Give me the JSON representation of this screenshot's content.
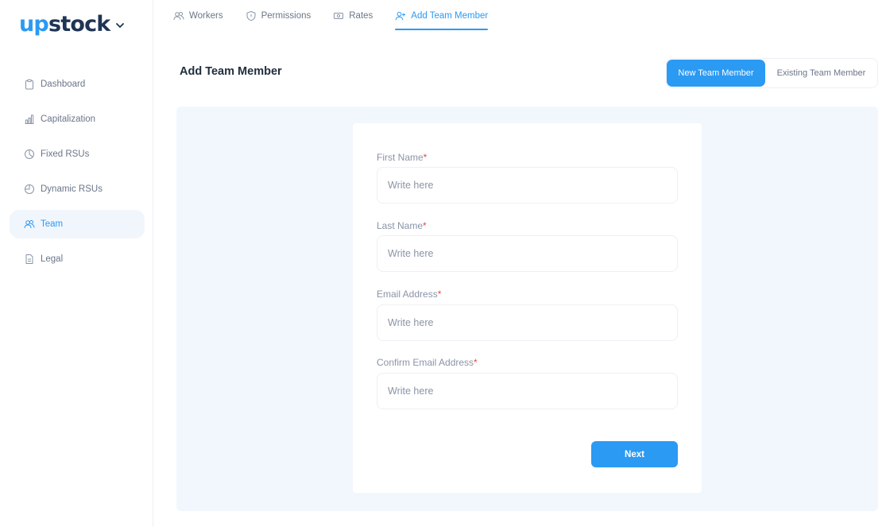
{
  "brand": {
    "logo_part1": "up",
    "logo_part2": "stock"
  },
  "sidebar": {
    "items": [
      {
        "label": "Dashboard",
        "icon": "clipboard-icon"
      },
      {
        "label": "Capitalization",
        "icon": "bar-chart-icon"
      },
      {
        "label": "Fixed RSUs",
        "icon": "pie-chart-icon"
      },
      {
        "label": "Dynamic RSUs",
        "icon": "pie-chart-icon"
      },
      {
        "label": "Team",
        "icon": "users-icon",
        "active": true
      },
      {
        "label": "Legal",
        "icon": "document-icon"
      }
    ]
  },
  "topnav": {
    "tabs": [
      {
        "label": "Workers",
        "icon": "users-icon"
      },
      {
        "label": "Permissions",
        "icon": "shield-icon"
      },
      {
        "label": "Rates",
        "icon": "money-icon"
      },
      {
        "label": "Add Team Member",
        "icon": "user-plus-icon",
        "active": true
      }
    ]
  },
  "page": {
    "title": "Add Team Member",
    "toggle": {
      "new_label": "New Team Member",
      "existing_label": "Existing Team Member",
      "selected": "New Team Member"
    }
  },
  "form": {
    "fields": [
      {
        "label": "First Name",
        "required_mark": "*",
        "placeholder": "Write here",
        "value": ""
      },
      {
        "label": "Last Name",
        "required_mark": "*",
        "placeholder": "Write here",
        "value": ""
      },
      {
        "label": "Email Address",
        "required_mark": "*",
        "placeholder": "Write here",
        "value": ""
      },
      {
        "label": "Confirm Email Address",
        "required_mark": "*",
        "placeholder": "Write here",
        "value": ""
      }
    ],
    "next_label": "Next"
  },
  "colors": {
    "accent": "#2b9af3",
    "brand_dark": "#1f3556",
    "panel_bg": "#f2f7fe",
    "required": "#e64a3b",
    "muted_text": "#6b7689"
  }
}
